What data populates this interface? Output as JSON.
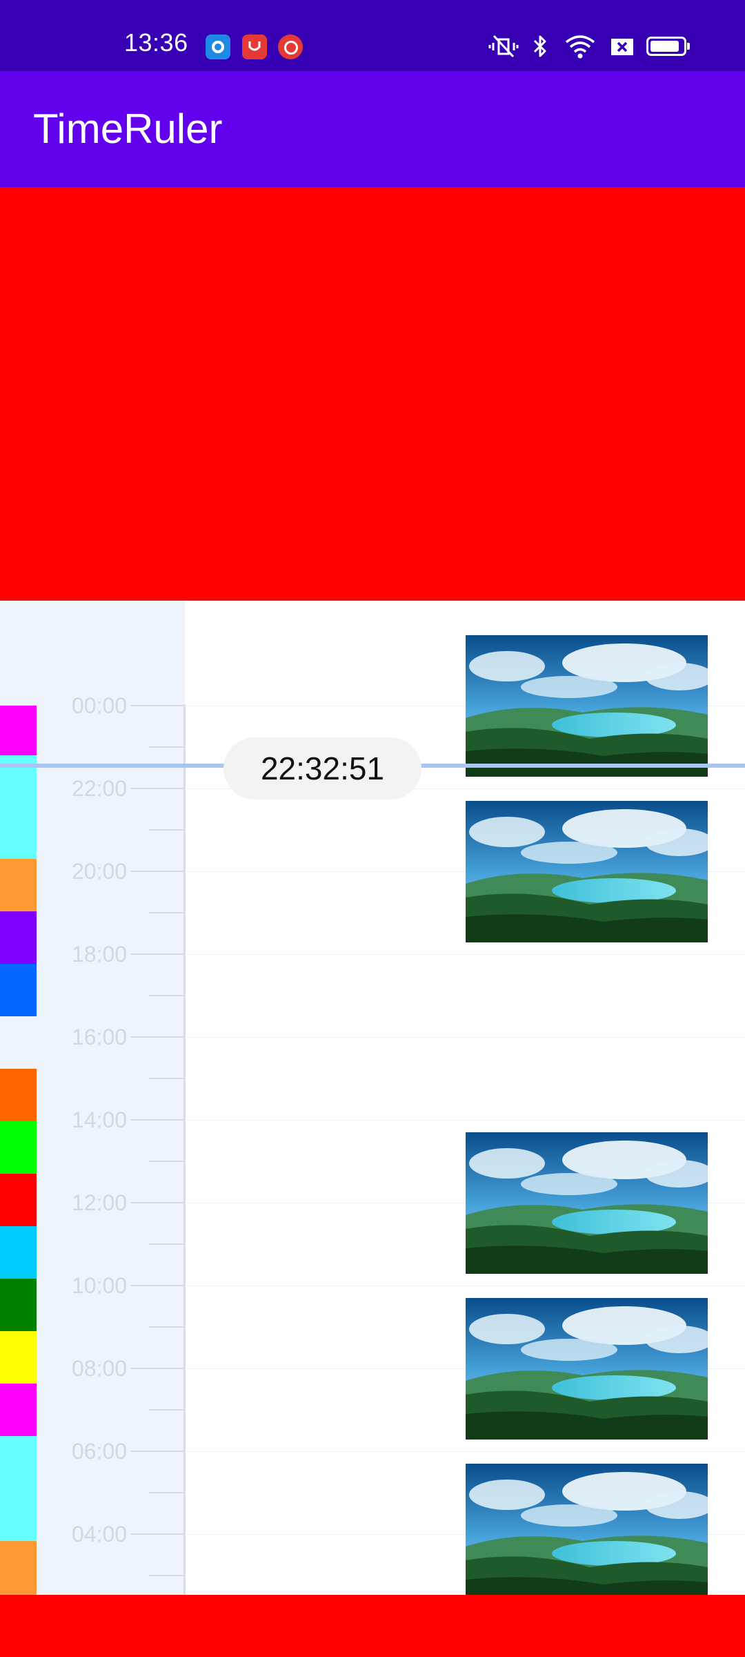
{
  "status_bar": {
    "time": "13:36",
    "notification_icons": [
      "circle-app-icon",
      "red-app-icon",
      "music-app-icon"
    ],
    "system_icons": [
      "vibrate-mute-icon",
      "bluetooth-icon",
      "wifi-icon",
      "sim-x-icon",
      "battery-icon"
    ],
    "battery_level": 0.9
  },
  "app_bar": {
    "title": "TimeRuler"
  },
  "ruler": {
    "current_time": "22:32:51",
    "hour_labels": [
      "00:00",
      "22:00",
      "20:00",
      "18:00",
      "16:00",
      "14:00",
      "12:00",
      "10:00",
      "08:00",
      "06:00",
      "04:00"
    ],
    "segment_colors": [
      "#ff00ff",
      "#66ffff",
      "#ff9933",
      "#7f00ff",
      "#0066ff",
      "#ff6600",
      "#00ff00",
      "#ff0000",
      "#00ccff",
      "#008000",
      "#ffff00",
      "#ff00ff",
      "#66ffff",
      "#ff9933"
    ],
    "thumbnail_icon": "landscape-image",
    "colors": {
      "cursor": "#aac4f4",
      "track_background": "#eef4fc"
    }
  },
  "colors": {
    "status_bar": "#3700b3",
    "app_bar": "#6200ee",
    "video_area": "#ff0000"
  }
}
